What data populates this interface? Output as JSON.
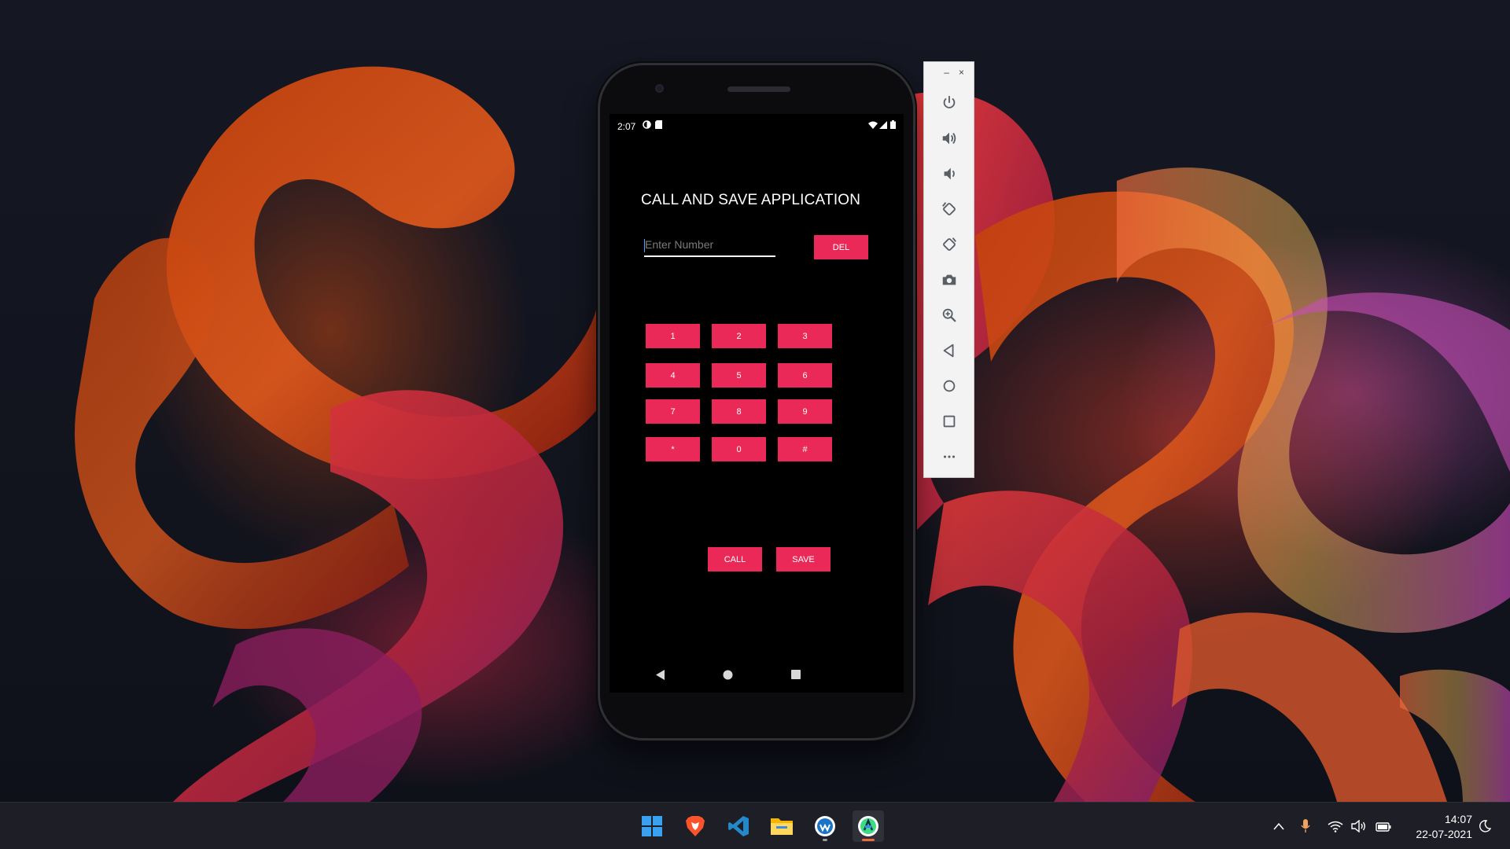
{
  "app": {
    "title": "CALL AND SAVE APPLICATION",
    "input_placeholder": "Enter Number",
    "input_value": "",
    "del_label": "DEL",
    "keypad": [
      "1",
      "2",
      "3",
      "4",
      "5",
      "6",
      "7",
      "8",
      "9",
      "*",
      "0",
      "#"
    ],
    "call_label": "CALL",
    "save_label": "SAVE",
    "accent_color": "#ea2958"
  },
  "status_bar": {
    "time": "2:07",
    "left_icons": [
      "data-saver-icon",
      "sd-card-icon"
    ],
    "right_icons": [
      "wifi-icon",
      "cell-signal-icon",
      "battery-icon"
    ]
  },
  "nav_bar": [
    "back-icon",
    "home-icon",
    "overview-icon"
  ],
  "emulator_toolbar": {
    "window_controls": [
      "–",
      "×"
    ],
    "buttons": [
      "power-icon",
      "volume-up-icon",
      "volume-down-icon",
      "rotate-left-icon",
      "rotate-right-icon",
      "camera-icon",
      "zoom-icon",
      "back-icon",
      "home-icon",
      "overview-icon",
      "more-icon"
    ]
  },
  "taskbar": {
    "apps": [
      "windows-start-icon",
      "brave-browser-icon",
      "vscode-icon",
      "file-explorer-icon",
      "wireshark-icon",
      "android-studio-icon"
    ],
    "tray": [
      "chevron-up-icon",
      "microphone-icon",
      "wifi-icon",
      "volume-icon",
      "battery-icon",
      "moon-icon"
    ],
    "time": "14:07",
    "date": "22-07-2021"
  }
}
